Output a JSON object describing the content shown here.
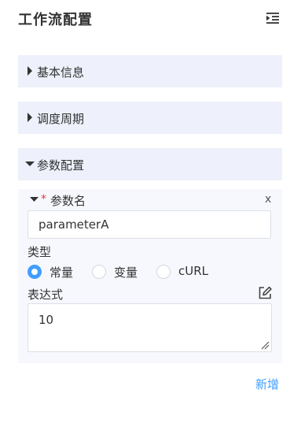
{
  "panel": {
    "title": "工作流配置",
    "collapse_icon": "menu-fold-icon"
  },
  "sections": [
    {
      "label": "基本信息",
      "expanded": false
    },
    {
      "label": "调度周期",
      "expanded": false
    },
    {
      "label": "参数配置",
      "expanded": true
    }
  ],
  "parameter": {
    "name_label": "参数名",
    "required_mark": "*",
    "close_label": "x",
    "name_value": "parameterA",
    "type_label": "类型",
    "type_options": [
      "常量",
      "变量",
      "cURL"
    ],
    "type_selected": "常量",
    "expression_label": "表达式",
    "expression_value": "10"
  },
  "actions": {
    "add_label": "新增"
  },
  "colors": {
    "accent": "#409eff",
    "section_bg": "#eef1fb",
    "card_bg": "#f7f8fd",
    "required": "#e53935"
  }
}
